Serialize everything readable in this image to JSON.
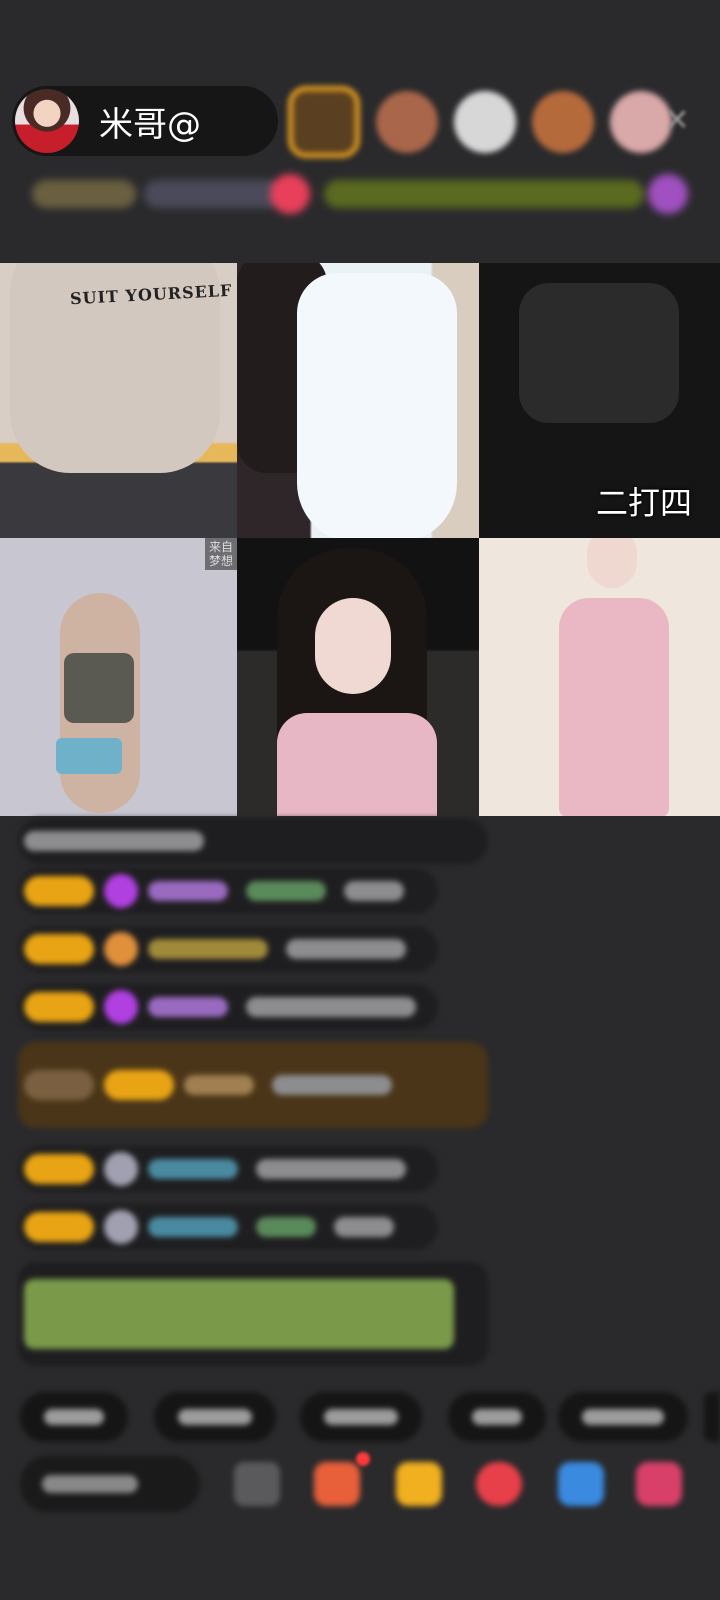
{
  "host": {
    "name": "米哥@"
  },
  "video_grid": {
    "shirt_text": "SUIT YOURSELF",
    "tile3_caption": "二打四",
    "tile4_badge_line1": "来自",
    "tile4_badge_line2": "梦想"
  },
  "icons": {
    "close": "close-icon",
    "gift": "gift-icon",
    "emoji": "emoji-icon"
  },
  "colors": {
    "background": "#2a2a2c",
    "level_badge": "#e8a414",
    "viewer_highlight": "#e8a020",
    "notification": "#ff3b3b"
  }
}
